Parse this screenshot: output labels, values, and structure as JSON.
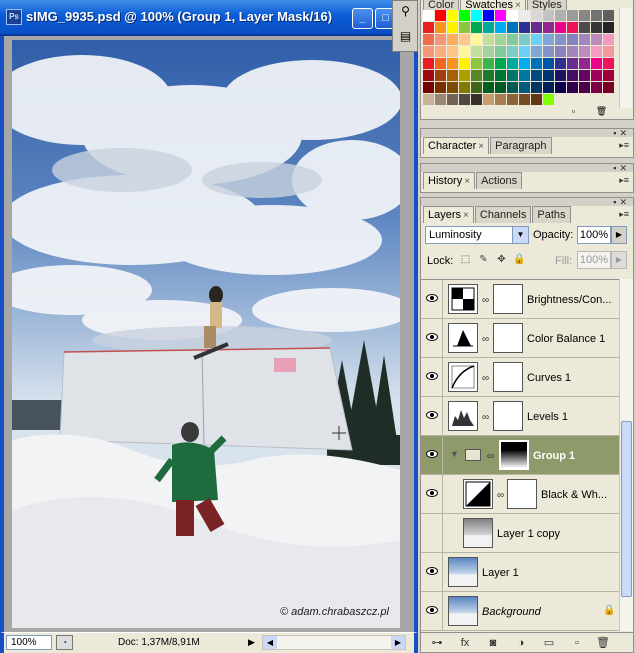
{
  "document": {
    "title": "sIMG_9935.psd @ 100% (Group 1, Layer Mask/16)",
    "app_badge": "Ps",
    "watermark": "© adam.chrabaszcz.pl",
    "status": {
      "zoom": "100%",
      "doc_size": "Doc: 1,37M/8,91M"
    }
  },
  "swatches_panel": {
    "tabs": [
      "Color",
      "Swatches",
      "Styles"
    ],
    "colors": [
      "#ffffff",
      "#ff0000",
      "#ffff00",
      "#00ff00",
      "#00ffff",
      "#0000ff",
      "#ff00ff",
      "#ffffff",
      "#ebebeb",
      "#d7d7d7",
      "#c3c3c3",
      "#afafaf",
      "#9b9b9b",
      "#878787",
      "#737373",
      "#5f5f5f",
      "#ed1c24",
      "#f7941d",
      "#fff200",
      "#8dc63f",
      "#00a651",
      "#00a99d",
      "#00aeef",
      "#0072bc",
      "#2e3192",
      "#662d91",
      "#92278f",
      "#ec008c",
      "#ed145b",
      "#4b4b4b",
      "#373737",
      "#232323",
      "#f26c4f",
      "#f69679",
      "#fbaf5d",
      "#fdc68a",
      "#fff799",
      "#c4df9b",
      "#a3d39c",
      "#82ca9c",
      "#7accc8",
      "#6dcff6",
      "#7da7d9",
      "#8393ca",
      "#8781bd",
      "#a187be",
      "#bd8cbf",
      "#f49ac1",
      "#f7977a",
      "#f9ad81",
      "#fdc689",
      "#fff79a",
      "#c4df9b",
      "#a2d39c",
      "#82ca9d",
      "#7bcdc8",
      "#6ecff6",
      "#7ea7d8",
      "#8493ca",
      "#8882be",
      "#a187be",
      "#bc8cbf",
      "#f49bc1",
      "#f5989d",
      "#ed1c24",
      "#f26522",
      "#f7941d",
      "#fff200",
      "#8dc63f",
      "#39b54a",
      "#00a651",
      "#00a99d",
      "#00aeef",
      "#0072bc",
      "#0054a6",
      "#2e3192",
      "#662d91",
      "#92278f",
      "#ec008c",
      "#ed145b",
      "#9e0b0f",
      "#a0410d",
      "#a36209",
      "#aba000",
      "#598527",
      "#1a7b30",
      "#007236",
      "#00746b",
      "#0076a3",
      "#004b80",
      "#003471",
      "#1b1464",
      "#440e62",
      "#630460",
      "#9e005d",
      "#9e0039",
      "#790000",
      "#7b2e00",
      "#7d4900",
      "#827b00",
      "#406618",
      "#005e20",
      "#005826",
      "#005952",
      "#005b7f",
      "#003663",
      "#002157",
      "#0d004c",
      "#32004b",
      "#4b0049",
      "#7b0046",
      "#7a0026",
      "#c7b299",
      "#998675",
      "#736357",
      "#534741",
      "#37302d",
      "#c69c6d",
      "#a67c52",
      "#8c6239",
      "#754c24",
      "#603913",
      "#7fff00",
      "#ece9d8",
      "#ece9d8",
      "#ece9d8",
      "#ece9d8",
      "#ece9d8"
    ]
  },
  "character_panel": {
    "tabs": [
      "Character",
      "Paragraph"
    ]
  },
  "history_panel": {
    "tabs": [
      "History",
      "Actions"
    ]
  },
  "layers_panel": {
    "tabs": [
      "Layers",
      "Channels",
      "Paths"
    ],
    "blend_mode": "Luminosity",
    "opacity_label": "Opacity:",
    "opacity": "100%",
    "lock_label": "Lock:",
    "fill_label": "Fill:",
    "fill": "100%",
    "layers": [
      {
        "name": "Brightness/Con...",
        "kind": "adjustment",
        "selected": false
      },
      {
        "name": "Color Balance 1",
        "kind": "adjustment",
        "selected": false
      },
      {
        "name": "Curves 1",
        "kind": "adjustment",
        "selected": false
      },
      {
        "name": "Levels 1",
        "kind": "adjustment",
        "selected": false
      },
      {
        "name": "Group 1",
        "kind": "group",
        "selected": true
      },
      {
        "name": "Black & Wh...",
        "kind": "adjustment-child",
        "selected": false
      },
      {
        "name": "Layer 1 copy",
        "kind": "pixel-child",
        "selected": false
      },
      {
        "name": "Layer 1",
        "kind": "pixel",
        "selected": false
      },
      {
        "name": "Background",
        "kind": "background",
        "selected": false
      }
    ]
  }
}
